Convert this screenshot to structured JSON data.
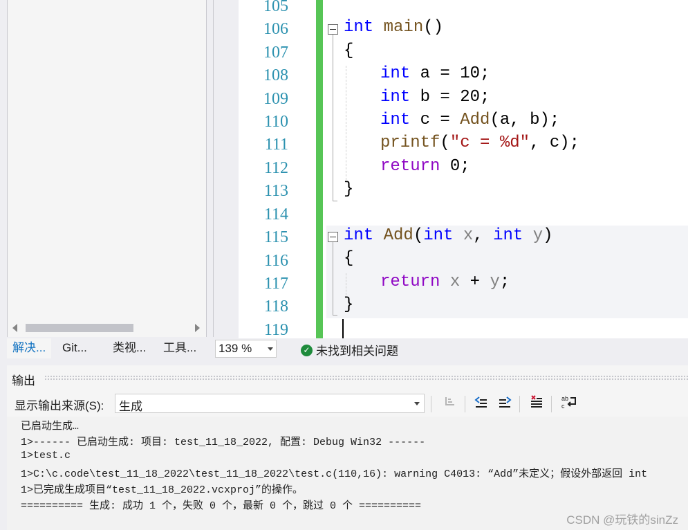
{
  "left_tabs": [
    "解决...",
    "Git...",
    "类视...",
    "工具..."
  ],
  "editor": {
    "line_numbers": [
      "105",
      "106",
      "107",
      "108",
      "109",
      "110",
      "111",
      "112",
      "113",
      "114",
      "115",
      "116",
      "117",
      "118",
      "119"
    ],
    "lines": {
      "l106": {
        "kw": "int",
        "fn": "main",
        "rest": "()"
      },
      "l107": "{",
      "l108": {
        "kw": "int",
        "rest": " a = 10;"
      },
      "l109": {
        "kw": "int",
        "rest": " b = 20;"
      },
      "l110": {
        "kw": "int",
        "a": " c = ",
        "fn": "Add",
        "b": "(a, b);"
      },
      "l111": {
        "fn": "printf",
        "a": "(",
        "str": "\"c = %d\"",
        "b": ", c);"
      },
      "l112": {
        "ctl": "return",
        "rest": " 0;"
      },
      "l113": "}",
      "l115": {
        "kw1": "int",
        "fn": "Add",
        "p1": "(",
        "kw2": "int",
        "x": " x",
        "comma": ", ",
        "kw3": "int",
        "y": " y",
        "p2": ")"
      },
      "l116": "{",
      "l117": {
        "ctl": "return",
        "x": " x",
        "op": " + ",
        "y": "y",
        "semi": ";"
      },
      "l118": "}"
    }
  },
  "status": {
    "zoom": "139 %",
    "issues": "未找到相关问题",
    "check_icon": "✓"
  },
  "output": {
    "title": "输出",
    "source_label": "显示输出来源(S):",
    "source_value": "生成",
    "lines": [
      "已启动生成…",
      "1>------ 已启动生成: 项目: test_11_18_2022, 配置: Debug Win32 ------",
      "1>test.c",
      "1>C:\\c.code\\test_11_18_2022\\test_11_18_2022\\test.c(110,16): warning C4013: “Add”未定义；假设外部返回 int",
      "1>已完成生成项目“test_11_18_2022.vcxproj”的操作。",
      "========== 生成: 成功 1 个，失败 0 个，最新 0 个，跳过 0 个 =========="
    ]
  },
  "watermark": "CSDN @玩铁的sinZz",
  "colors": {
    "keyword": "#0000ff",
    "function": "#74531f",
    "control": "#8f08c4",
    "string": "#a31515",
    "line_number": "#2b91af",
    "change_bar": "#57c556"
  }
}
